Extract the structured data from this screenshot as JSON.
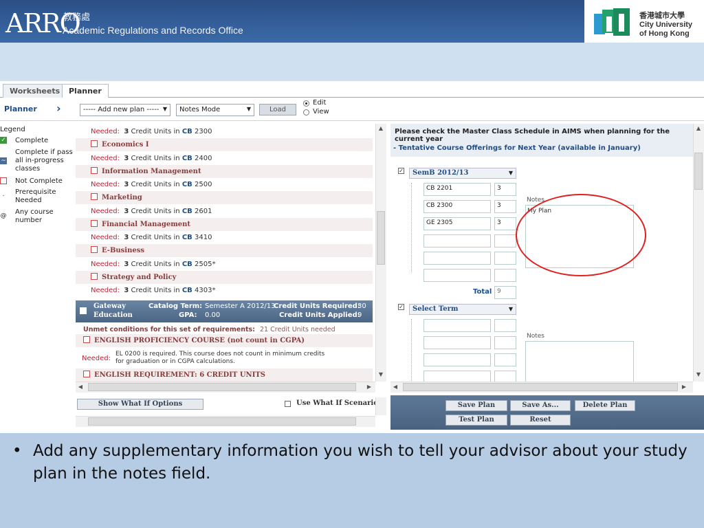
{
  "header": {
    "logo_text": "ARRO",
    "office_zh": "教務處",
    "office_en": "Academic Regulations and Records Office",
    "university_zh": "香港城市大學",
    "university_en_1": "City University",
    "university_en_2": "of Hong Kong"
  },
  "tabs": [
    {
      "label": "Worksheets",
      "active": false
    },
    {
      "label": "Planner",
      "active": true
    }
  ],
  "toolbar": {
    "planner_label": "Planner",
    "plan_select": "----- Add new plan -----",
    "mode_select": "Notes Mode",
    "load_button": "Load",
    "radio_edit": "Edit",
    "radio_view": "View",
    "selected_radio": "Edit"
  },
  "legend": {
    "title": "Legend",
    "items": [
      {
        "icon": "check-icon",
        "label": "Complete"
      },
      {
        "icon": "tilde-icon",
        "label": "Complete if pass all in-progress classes"
      },
      {
        "icon": "empty-box-icon",
        "label": "Not Complete"
      },
      {
        "icon": "dot-icon",
        "label": "Prerequisite Needed"
      },
      {
        "icon": "at-icon",
        "label": "Any course number"
      }
    ]
  },
  "requirements": [
    {
      "needed_label": "Needed:",
      "units": "3",
      "units_text": "Credit Units in",
      "dept": "CB",
      "num": "2300",
      "subject": "Economics I"
    },
    {
      "needed_label": "Needed:",
      "units": "3",
      "units_text": "Credit Units in",
      "dept": "CB",
      "num": "2400",
      "subject": "Information Management"
    },
    {
      "needed_label": "Needed:",
      "units": "3",
      "units_text": "Credit Units in",
      "dept": "CB",
      "num": "2500",
      "subject": "Marketing"
    },
    {
      "needed_label": "Needed:",
      "units": "3",
      "units_text": "Credit Units in",
      "dept": "CB",
      "num": "2601",
      "subject": "Financial Management"
    },
    {
      "needed_label": "Needed:",
      "units": "3",
      "units_text": "Credit Units in",
      "dept": "CB",
      "num": "3410",
      "subject": "E-Business"
    },
    {
      "needed_label": "Needed:",
      "units": "3",
      "units_text": "Credit Units in",
      "dept": "CB",
      "num": "2505*",
      "subject": "Strategy and Policy"
    },
    {
      "needed_label": "Needed:",
      "units": "3",
      "units_text": "Credit Units in",
      "dept": "CB",
      "num": "4303*",
      "subject": ""
    }
  ],
  "gateway": {
    "name_1": "Gateway",
    "name_2": "Education",
    "catalog_label": "Catalog Term:",
    "catalog_value": "Semester A 2012/13",
    "gpa_label": "GPA:",
    "gpa_value": "0.00",
    "required_label": "Credit Units Required:",
    "required_value": "30",
    "applied_label": "Credit Units Applied:",
    "applied_value": "9"
  },
  "unmet": {
    "label": "Unmet conditions for this set of requirements:",
    "value": "21 Credit Units needed",
    "english_proficiency": "ENGLISH PROFICIENCY COURSE (not count in CGPA)",
    "needed_label": "Needed:",
    "note_1": "EL 0200 is required. This course does not count in minimum credits",
    "note_2": "for graduation or in CGPA calculations.",
    "english_requirement": "ENGLISH REQUIREMENT: 6 CREDIT UNITS"
  },
  "left_bottom": {
    "show_options_button": "Show What If Options",
    "use_scenario_label": "Use What If Scenario"
  },
  "right": {
    "notice": "Please check the Master Class Schedule in AIMS when planning for the current year",
    "tentative": "- Tentative Course Offerings for Next Year (available in January)",
    "term1": {
      "select": "SemB 2012/13",
      "courses": [
        {
          "code": "CB 2201",
          "units": "3"
        },
        {
          "code": "CB 2300",
          "units": "3"
        },
        {
          "code": "GE 2305",
          "units": "3"
        },
        {
          "code": "",
          "units": ""
        },
        {
          "code": "",
          "units": ""
        },
        {
          "code": "",
          "units": ""
        }
      ],
      "notes_label": "Notes",
      "notes_value": "My Plan",
      "total_label": "Total",
      "total_value": "9"
    },
    "term2": {
      "select": "Select Term",
      "notes_label": "Notes"
    }
  },
  "actions": {
    "save_plan": "Save Plan",
    "save_as": "Save As...",
    "delete_plan": "Delete Plan",
    "test_plan": "Test Plan",
    "reset": "Reset"
  },
  "caption": {
    "bullet": "•",
    "text": "Add any supplementary information you wish to tell your advisor about your study plan in the notes field."
  },
  "colors": {
    "header_blue": "#2c4f86",
    "caption_bg": "#b6cbe4",
    "annotation_red": "#e02020",
    "needed_red": "#b22233",
    "link_blue": "#1d4e89"
  }
}
